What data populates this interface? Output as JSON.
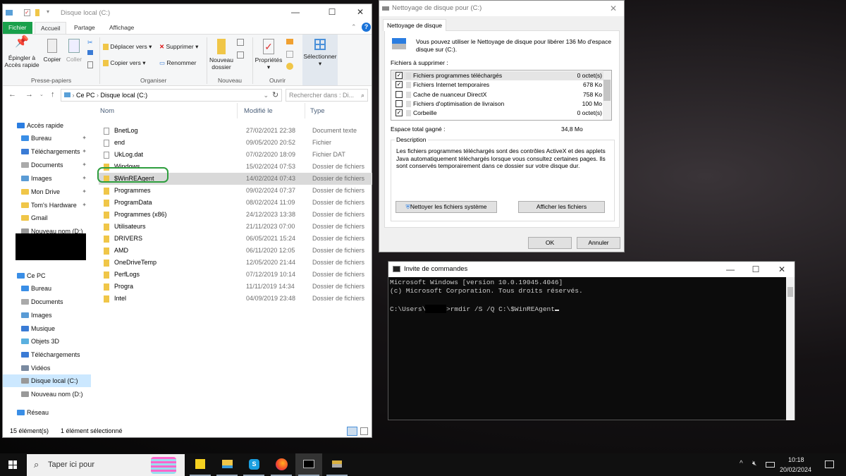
{
  "explorer": {
    "title": "Disque local (C:)",
    "tabs": [
      "Fichier",
      "Accueil",
      "Partage",
      "Affichage"
    ],
    "ribbon": {
      "pin": "Épingler à Accès rapide",
      "copy": "Copier",
      "paste": "Coller",
      "move": "Déplacer vers",
      "copyto": "Copier vers",
      "delete": "Supprimer",
      "rename": "Renommer",
      "newfolder": "Nouveau dossier",
      "props": "Propriétés",
      "select": "Sélectionner",
      "groups": [
        "Presse-papiers",
        "Organiser",
        "Nouveau",
        "Ouvrir"
      ]
    },
    "breadcrumb": [
      "Ce PC",
      "Disque local (C:)"
    ],
    "search_placeholder": "Rechercher dans : Di...",
    "columns": [
      "Nom",
      "Modifié le",
      "Type"
    ],
    "nav": [
      {
        "label": "Accès rapide",
        "top": true,
        "color": "#2a7de1"
      },
      {
        "label": "Bureau",
        "pin": true,
        "color": "#3a8ee6"
      },
      {
        "label": "Téléchargements",
        "pin": true,
        "color": "#3a7bd5"
      },
      {
        "label": "Documents",
        "pin": true,
        "color": "#aaa"
      },
      {
        "label": "Images",
        "pin": true,
        "color": "#5a9bd5"
      },
      {
        "label": "Mon Drive",
        "pin": true,
        "color": "#f0c648"
      },
      {
        "label": "Tom's Hardware",
        "pin": true,
        "color": "#f0c648"
      },
      {
        "label": "Gmail",
        "color": "#f0c648"
      },
      {
        "label": "Nouveau nom (D:)",
        "color": "#999"
      },
      {
        "label": "",
        "redacted": true
      },
      {
        "label": "Ce PC",
        "top": true,
        "color": "#3a8ee6"
      },
      {
        "label": "Bureau",
        "color": "#3a8ee6"
      },
      {
        "label": "Documents",
        "color": "#aaa"
      },
      {
        "label": "Images",
        "color": "#5a9bd5"
      },
      {
        "label": "Musique",
        "color": "#3a7bd5"
      },
      {
        "label": "Objets 3D",
        "color": "#5ab0e0"
      },
      {
        "label": "Téléchargements",
        "color": "#3a7bd5"
      },
      {
        "label": "Vidéos",
        "color": "#7a8aa0"
      },
      {
        "label": "Disque local (C:)",
        "color": "#999",
        "selected": true
      },
      {
        "label": "Nouveau nom (D:)",
        "color": "#999"
      },
      {
        "label": "Réseau",
        "top": true,
        "color": "#3a8ee6"
      }
    ],
    "files": [
      {
        "name": "BnetLog",
        "date": "27/02/2021 22:38",
        "type": "Document texte",
        "kind": "file"
      },
      {
        "name": "end",
        "date": "09/05/2020 20:52",
        "type": "Fichier",
        "kind": "file"
      },
      {
        "name": "UkLog.dat",
        "date": "07/02/2020 18:09",
        "type": "Fichier DAT",
        "kind": "file"
      },
      {
        "name": "Windows",
        "date": "15/02/2024 07:53",
        "type": "Dossier de fichiers",
        "kind": "folder"
      },
      {
        "name": "$WinREAgent",
        "date": "14/02/2024 07:43",
        "type": "Dossier de fichiers",
        "kind": "folder",
        "selected": true
      },
      {
        "name": "Programmes",
        "date": "09/02/2024 07:37",
        "type": "Dossier de fichiers",
        "kind": "folder"
      },
      {
        "name": "ProgramData",
        "date": "08/02/2024 11:09",
        "type": "Dossier de fichiers",
        "kind": "folder"
      },
      {
        "name": "Programmes (x86)",
        "date": "24/12/2023 13:38",
        "type": "Dossier de fichiers",
        "kind": "folder"
      },
      {
        "name": "Utilisateurs",
        "date": "21/11/2023 07:00",
        "type": "Dossier de fichiers",
        "kind": "folder"
      },
      {
        "name": "DRIVERS",
        "date": "06/05/2021 15:24",
        "type": "Dossier de fichiers",
        "kind": "folder"
      },
      {
        "name": "AMD",
        "date": "06/11/2020 12:05",
        "type": "Dossier de fichiers",
        "kind": "folder"
      },
      {
        "name": "OneDriveTemp",
        "date": "12/05/2020 21:44",
        "type": "Dossier de fichiers",
        "kind": "folder"
      },
      {
        "name": "PerfLogs",
        "date": "07/12/2019 10:14",
        "type": "Dossier de fichiers",
        "kind": "folder"
      },
      {
        "name": "Progra",
        "date": "11/11/2019 14:34",
        "type": "Dossier de fichiers",
        "kind": "folder"
      },
      {
        "name": "Intel",
        "date": "04/09/2019 23:48",
        "type": "Dossier de fichiers",
        "kind": "folder"
      }
    ],
    "status_count": "15 élément(s)",
    "status_selected": "1 élément sélectionné",
    "highlight_color": "#2e9e3e"
  },
  "cleanup": {
    "title": "Nettoyage de disque pour  (C:)",
    "tab": "Nettoyage de disque",
    "intro": "Vous pouvez utiliser le Nettoyage de disque pour libérer 136 Mo d'espace disque sur (C:).",
    "files_label": "Fichiers à supprimer :",
    "items": [
      {
        "label": "Fichiers programmes téléchargés",
        "size": "0 octet(s)",
        "checked": true
      },
      {
        "label": "Fichiers Internet temporaires",
        "size": "678 Ko",
        "checked": true
      },
      {
        "label": "Cache de nuanceur DirectX",
        "size": "758 Ko",
        "checked": false
      },
      {
        "label": "Fichiers d'optimisation de livraison",
        "size": "100 Mo",
        "checked": false
      },
      {
        "label": "Corbeille",
        "size": "0 octet(s)",
        "checked": true
      }
    ],
    "total_label": "Espace total gagné :",
    "total_value": "34,8 Mo",
    "desc_label": "Description",
    "desc": "Les fichiers programmes téléchargés sont des contrôles ActiveX et des applets Java automatiquement téléchargés lorsque vous consultez certaines pages. Ils sont conservés temporairement dans ce dossier sur votre disque dur.",
    "btn_system": "Nettoyer les fichiers système",
    "btn_view": "Afficher les fichiers",
    "ok": "OK",
    "cancel": "Annuler"
  },
  "cmd": {
    "title": "Invite de commandes",
    "line1": "Microsoft Windows [version 10.0.19045.4046]",
    "line2": "(c) Microsoft Corporation. Tous droits réservés.",
    "prompt": "C:\\Users\\",
    "command": ">rmdir /S /Q C:\\$WinREAgent"
  },
  "taskbar": {
    "search": "Taper ici pour",
    "time": "10:18",
    "date": "20/02/2024"
  }
}
